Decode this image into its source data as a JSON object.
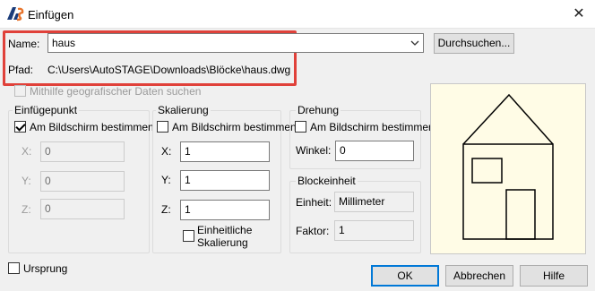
{
  "dialog": {
    "title": "Einfügen",
    "close_glyph": "✕",
    "app_icon": "autostage-logo-icon"
  },
  "name": {
    "label": "Name:",
    "value": "haus"
  },
  "browse_button": "Durchsuchen...",
  "path": {
    "label": "Pfad:",
    "value": "C:\\Users\\AutoSTAGE\\Downloads\\Blöcke\\haus.dwg"
  },
  "geo_checkbox": {
    "label": "Mithilfe geografischer Daten suchen",
    "checked": false,
    "enabled": false
  },
  "insertion_point": {
    "legend": "Einfügepunkt",
    "onscreen_label": "Am Bildschirm bestimmen",
    "onscreen_checked": true,
    "x_label": "X:",
    "x_value": "0",
    "y_label": "Y:",
    "y_value": "0",
    "z_label": "Z:",
    "z_value": "0"
  },
  "scale": {
    "legend": "Skalierung",
    "onscreen_label": "Am Bildschirm bestimmen",
    "onscreen_checked": false,
    "x_label": "X:",
    "x_value": "1",
    "y_label": "Y:",
    "y_value": "1",
    "z_label": "Z:",
    "z_value": "1",
    "uniform_label_line1": "Einheitliche",
    "uniform_label_line2": "Skalierung",
    "uniform_checked": false
  },
  "rotation": {
    "legend": "Drehung",
    "onscreen_label": "Am Bildschirm bestimmen",
    "onscreen_checked": false,
    "angle_label": "Winkel:",
    "angle_value": "0"
  },
  "block_unit": {
    "legend": "Blockeinheit",
    "unit_label": "Einheit:",
    "unit_value": "Millimeter",
    "factor_label": "Faktor:",
    "factor_value": "1"
  },
  "explode_checkbox": {
    "label": "Ursprung",
    "checked": false
  },
  "buttons": {
    "ok": "OK",
    "cancel": "Abbrechen",
    "help": "Hilfe"
  },
  "colors": {
    "highlight": "#e0413a",
    "default_button_border": "#0078d7",
    "preview_bg": "#fffce6"
  }
}
